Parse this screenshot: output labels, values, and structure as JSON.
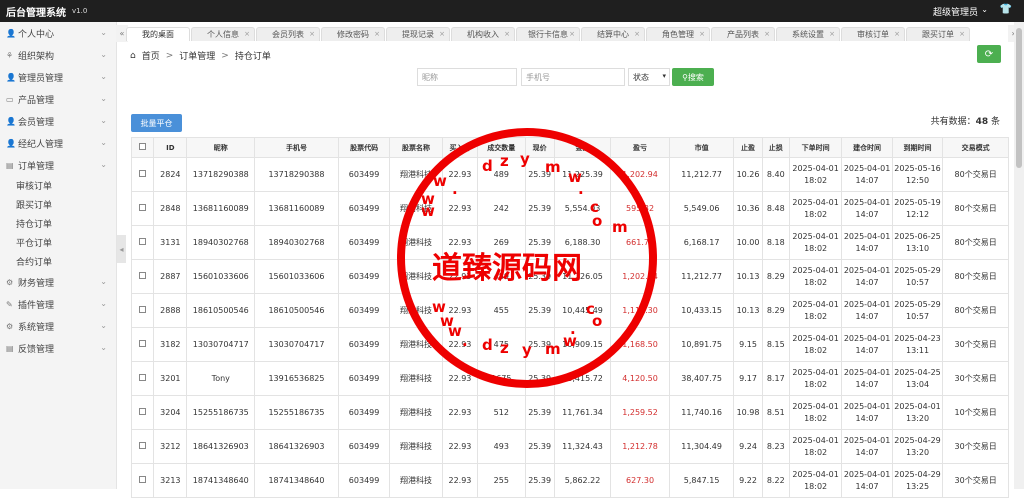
{
  "header": {
    "title": "后台管理系统",
    "version": "v1.0",
    "user": "超级管理员"
  },
  "sidebar": {
    "menus": [
      {
        "label": "个人中心",
        "icon": "user-icon"
      },
      {
        "label": "组织架构",
        "icon": "org-icon"
      },
      {
        "label": "管理员管理",
        "icon": "admin-icon"
      },
      {
        "label": "产品管理",
        "icon": "product-icon"
      },
      {
        "label": "会员管理",
        "icon": "member-icon"
      },
      {
        "label": "经纪人管理",
        "icon": "agent-icon"
      },
      {
        "label": "订单管理",
        "icon": "order-icon"
      }
    ],
    "order_sub": [
      "审核订单",
      "跟买订单",
      "持仓订单",
      "平仓订单",
      "合约订单"
    ],
    "menus2": [
      {
        "label": "财务管理",
        "icon": "finance-icon"
      },
      {
        "label": "插件管理",
        "icon": "plugin-icon"
      },
      {
        "label": "系统管理",
        "icon": "system-icon"
      },
      {
        "label": "反馈管理",
        "icon": "feedback-icon"
      }
    ]
  },
  "tabs": [
    "我的桌面",
    "个人信息",
    "会员列表",
    "修改密码",
    "提现记录",
    "机构收入",
    "银行卡信息",
    "结算中心",
    "角色管理",
    "产品列表",
    "系统设置",
    "审核订单",
    "跟买订单"
  ],
  "breadcrumb": {
    "home": "首页",
    "level1": "订单管理",
    "level2": "持仓订单"
  },
  "search": {
    "nickname_placeholder": "昵称",
    "phone_placeholder": "手机号",
    "status_value": "状态",
    "button": "搜索"
  },
  "batch_button": "批量平仓",
  "total": {
    "prefix": "共有数据：",
    "count": "48",
    "suffix": "条"
  },
  "table": {
    "headers": [
      "ID",
      "昵称",
      "手机号",
      "股票代码",
      "股票名称",
      "买入价",
      "成交数量",
      "现价",
      "金额",
      "盈亏",
      "市值",
      "止盈",
      "止损",
      "下单时间",
      "建仓时间",
      "到期时间",
      "交易模式"
    ],
    "rows": [
      [
        "2824",
        "13718290388",
        "13718290388",
        "603499",
        "翔港科技",
        "22.93",
        "489",
        "25.39",
        "11,225.39",
        "1,202.94",
        "11,212.77",
        "10.26",
        "8.40",
        "2025-04-01 18:02",
        "2025-04-01 14:07",
        "2025-05-16 12:50",
        "80个交易日"
      ],
      [
        "2848",
        "13681160089",
        "13681160089",
        "603499",
        "翔港科技",
        "22.93",
        "242",
        "25.39",
        "5,554.03",
        "595.32",
        "5,549.06",
        "10.36",
        "8.48",
        "2025-04-01 18:02",
        "2025-04-01 14:07",
        "2025-05-19 12:12",
        "80个交易日"
      ],
      [
        "3131",
        "18940302768",
        "18940302768",
        "603499",
        "翔港科技",
        "22.93",
        "269",
        "25.39",
        "6,188.30",
        "661.74",
        "6,168.17",
        "10.00",
        "8.18",
        "2025-04-01 18:02",
        "2025-04-01 14:07",
        "2025-06-25 13:10",
        "80个交易日"
      ],
      [
        "2887",
        "15601033606",
        "15601033606",
        "603499",
        "翔港科技",
        "22.93",
        "489",
        "25.39",
        "11,226.05",
        "1,202.94",
        "11,212.77",
        "10.13",
        "8.29",
        "2025-04-01 18:02",
        "2025-04-01 14:07",
        "2025-05-29 10:57",
        "80个交易日"
      ],
      [
        "2888",
        "18610500546",
        "18610500546",
        "603499",
        "翔港科技",
        "22.93",
        "455",
        "25.39",
        "10,445.49",
        "1,119.30",
        "10,433.15",
        "10.13",
        "8.29",
        "2025-04-01 18:02",
        "2025-04-01 14:07",
        "2025-05-29 10:57",
        "80个交易日"
      ],
      [
        "3182",
        "13030704717",
        "13030704717",
        "603499",
        "翔港科技",
        "22.93",
        "475",
        "25.39",
        "10,909.15",
        "1,168.50",
        "10,891.75",
        "9.15",
        "8.15",
        "2025-04-01 18:02",
        "2025-04-01 14:07",
        "2025-04-23 13:11",
        "30个交易日"
      ],
      [
        "3201",
        "Tony",
        "13916536825",
        "603499",
        "翔港科技",
        "22.93",
        "1675",
        "25.39",
        "38,415.72",
        "4,120.50",
        "38,407.75",
        "9.17",
        "8.17",
        "2025-04-01 18:02",
        "2025-04-01 14:07",
        "2025-04-25 13:04",
        "30个交易日"
      ],
      [
        "3204",
        "15255186735",
        "15255186735",
        "603499",
        "翔港科技",
        "22.93",
        "512",
        "25.39",
        "11,761.34",
        "1,259.52",
        "11,740.16",
        "10.98",
        "8.51",
        "2025-04-01 18:02",
        "2025-04-01 14:07",
        "2025-04-01 13:20",
        "10个交易日"
      ],
      [
        "3212",
        "18641326903",
        "18641326903",
        "603499",
        "翔港科技",
        "22.93",
        "493",
        "25.39",
        "11,324.43",
        "1,212.78",
        "11,304.49",
        "9.24",
        "8.23",
        "2025-04-01 18:02",
        "2025-04-01 14:07",
        "2025-04-29 13:20",
        "30个交易日"
      ],
      [
        "3213",
        "18741348640",
        "18741348640",
        "603499",
        "翔港科技",
        "22.93",
        "255",
        "25.39",
        "5,862.22",
        "627.30",
        "5,847.15",
        "9.22",
        "8.22",
        "2025-04-01 18:02",
        "2025-04-01 14:07",
        "2025-04-29 13:25",
        "30个交易日"
      ]
    ]
  },
  "watermark": {
    "text": "道臻源码网",
    "chars": [
      "w",
      "w",
      "w",
      ".",
      "d",
      "z",
      "y",
      "m",
      "w",
      ".",
      "c",
      "o",
      "m",
      "w",
      "w",
      "w",
      ".",
      "d",
      "z",
      "y",
      "m",
      "w",
      ".",
      "c",
      "o",
      "m"
    ]
  },
  "colors": {
    "accent_green": "#4caf50",
    "accent_blue": "#4a90d9",
    "loss_red": "#d32f2f",
    "watermark_red": "#e00000"
  }
}
